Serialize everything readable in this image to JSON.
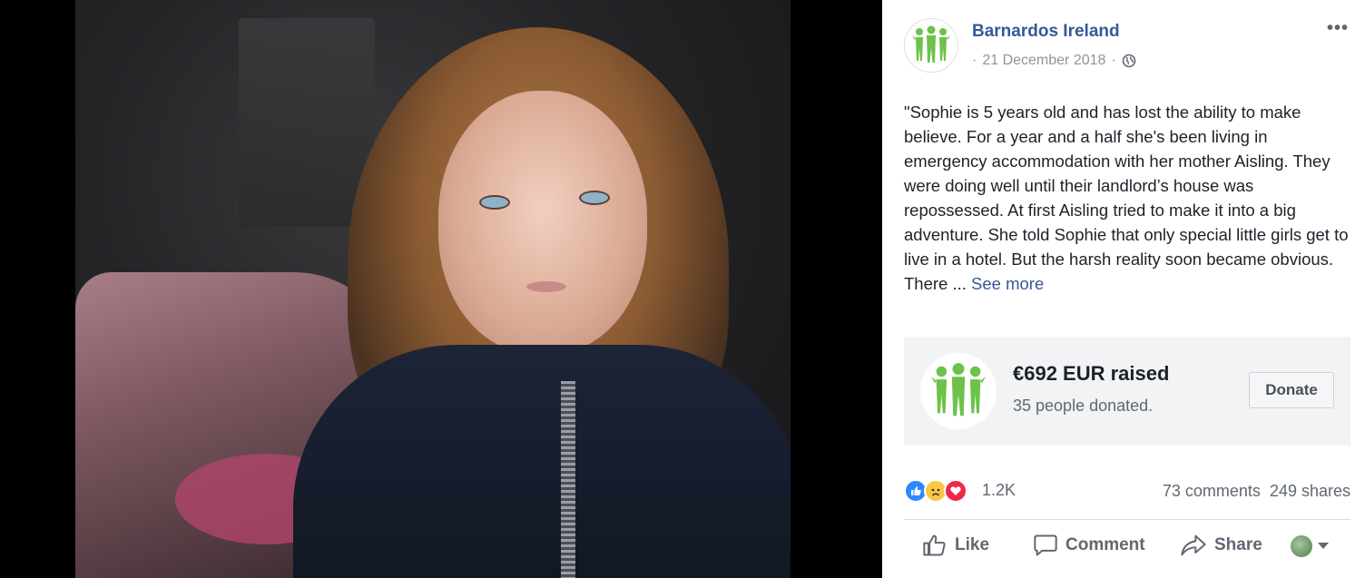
{
  "post": {
    "page_name": "Barnardos Ireland",
    "date": "21 December 2018",
    "separator": "·",
    "text": "\"Sophie is 5 years old and has lost the ability to make believe. For a year and a half she's been living in emergency accommodation with her mother Aisling. They were doing well until their landlord’s house was repossessed. At first Aisling tried to make it into a big adventure. She told Sophie that only special little girls get to live in a hotel. But the harsh reality soon became obvious. There ...",
    "see_more": "See more",
    "more_options": "•••"
  },
  "fundraiser": {
    "amount": "€692 EUR raised",
    "donors": "35 people donated.",
    "donate_label": "Donate"
  },
  "stats": {
    "reaction_count": "1.2K",
    "comments": "73 comments",
    "shares": "249 shares"
  },
  "actions": {
    "like": "Like",
    "comment": "Comment",
    "share": "Share"
  },
  "icons": {
    "logo": "barnardos-logo-icon",
    "globe": "globe-icon",
    "like": "thumbs-up-icon",
    "comment": "speech-bubble-icon",
    "share": "share-arrow-icon",
    "caret": "caret-down-icon"
  },
  "colors": {
    "brand_green": "#6cc24a",
    "link_blue": "#365899",
    "text_dark": "#1d2129",
    "text_grey": "#606770",
    "fund_bg": "#f2f3f5"
  }
}
